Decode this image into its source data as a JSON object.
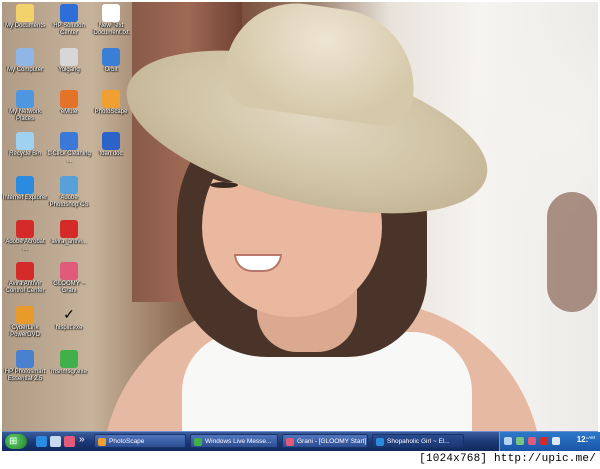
{
  "desktop": {
    "icons": [
      {
        "label": "My Documents",
        "icon": "my-documents-icon",
        "color": "#f2d36b"
      },
      {
        "label": "HP Solution Center",
        "icon": "hp-solution-center-icon",
        "color": "#2d6fd6"
      },
      {
        "label": "New Text Document.txt",
        "icon": "text-document-icon",
        "color": "#ffffff"
      },
      {
        "label": "My Computer",
        "icon": "my-computer-icon",
        "color": "#8fb6e6"
      },
      {
        "label": "Yoigang",
        "icon": "yoigang-icon",
        "color": "#d7d7d7"
      },
      {
        "label": "Orbit",
        "icon": "orbit-icon",
        "color": "#3a7fd6"
      },
      {
        "label": "My Network Places",
        "icon": "network-places-icon",
        "color": "#4f96e0"
      },
      {
        "label": "eMule",
        "icon": "emule-icon",
        "color": "#e4732a"
      },
      {
        "label": "PhotoScape",
        "icon": "photoscape-icon",
        "color": "#f0a030"
      },
      {
        "label": "Recycle Bin",
        "icon": "recycle-bin-icon",
        "color": "#9fd2f0"
      },
      {
        "label": "1-Click Cleaning ...",
        "icon": "cleaning-icon",
        "color": "#3c78d8"
      },
      {
        "label": "toan.doc",
        "icon": "word-document-icon",
        "color": "#2b63c8"
      },
      {
        "label": "Internet Explorer",
        "icon": "internet-explorer-icon",
        "color": "#2a8be0"
      },
      {
        "label": "Adobe Photoshop CS",
        "icon": "photoshop-icon",
        "color": "#5aa0d8"
      },
      {
        "label": "Adobe Acrobat ...",
        "icon": "adobe-acrobat-icon",
        "color": "#d42a2a"
      },
      {
        "label": "avira_antivi...",
        "icon": "avira-icon",
        "color": "#d42a2a"
      },
      {
        "label": "Avira AntiVir Control Center",
        "icon": "avira-control-center-icon",
        "color": "#d42a2a"
      },
      {
        "label": "GLOOMY ~ Grani",
        "icon": "gloomy-grani-icon",
        "color": "#e05a7a"
      },
      {
        "label": "CyberLink PowerDVD",
        "icon": "powerdvd-icon",
        "color": "#e89a2a"
      },
      {
        "label": "hisplit.exe",
        "icon": "checkmark-icon",
        "color": "#000000"
      },
      {
        "label": "HP Photosmart Essential 2.5",
        "icon": "hp-photosmart-icon",
        "color": "#4a80d0"
      },
      {
        "label": "msnmsgr.exe",
        "icon": "msn-messenger-icon",
        "color": "#3fb04a"
      }
    ]
  },
  "taskbar": {
    "start_icon": "windows-start-icon",
    "quick_launch": [
      "ie-quicklaunch-icon",
      "show-desktop-icon",
      "messenger-quicklaunch-icon"
    ],
    "overflow": "»",
    "tasks": [
      {
        "label": "PhotoScape",
        "icon": "photoscape-icon",
        "color": "#f0a030",
        "active": false
      },
      {
        "label": "Windows Live Messe...",
        "icon": "msn-messenger-icon",
        "color": "#3fb04a",
        "active": false
      },
      {
        "label": "Grani - [GLOOMY Start]",
        "icon": "gloomy-grani-icon",
        "color": "#e05a7a",
        "active": false
      },
      {
        "label": "Shopaholic Girl ~ El...",
        "icon": "internet-explorer-icon",
        "color": "#2a8be0",
        "active": true
      }
    ],
    "tray_icons": [
      "tray-arrow-icon",
      "tray-network-icon",
      "tray-messenger-icon",
      "tray-avira-icon",
      "tray-volume-icon"
    ],
    "clock": {
      "time": "12:",
      "suffix": "AM"
    }
  },
  "watermark": "[1024x768] http://upic.me/"
}
